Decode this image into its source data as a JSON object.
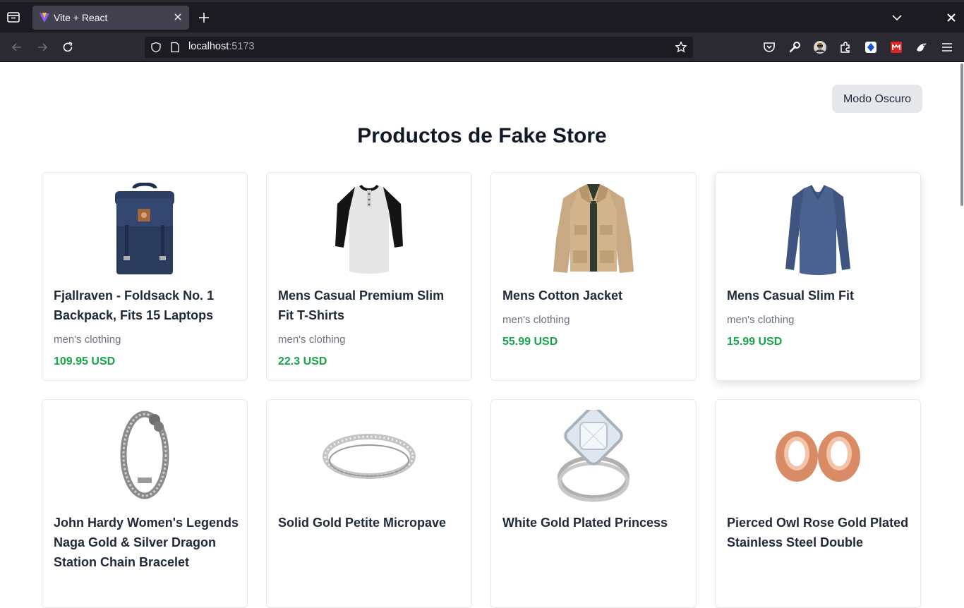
{
  "browser": {
    "tab_title": "Vite + React",
    "url_host": "localhost",
    "url_port": ":5173",
    "toolbar_icons": [
      "pocket-icon",
      "wrench-icon",
      "profile-avatar",
      "extensions-icon",
      "extension-blue-icon",
      "extension-red-icon",
      "extension-bird-icon",
      "menu-icon"
    ]
  },
  "page": {
    "mode_button": "Modo Oscuro",
    "title": "Productos de Fake Store"
  },
  "products": [
    {
      "name": "Fjallraven - Foldsack No. 1 Backpack, Fits 15 Laptops",
      "category": "men's clothing",
      "price": "109.95 USD",
      "image": "backpack"
    },
    {
      "name": "Mens Casual Premium Slim Fit T-Shirts",
      "category": "men's clothing",
      "price": "22.3 USD",
      "image": "raglan-shirt"
    },
    {
      "name": "Mens Cotton Jacket",
      "category": "men's clothing",
      "price": "55.99 USD",
      "image": "jacket"
    },
    {
      "name": "Mens Casual Slim Fit",
      "category": "men's clothing",
      "price": "15.99 USD",
      "image": "long-sleeve-shirt"
    },
    {
      "name": "John Hardy Women's Legends Naga Gold & Silver Dragon Station Chain Bracelet",
      "image": "bracelet"
    },
    {
      "name": "Solid Gold Petite Micropave",
      "image": "silver-ring"
    },
    {
      "name": "White Gold Plated Princess",
      "image": "diamond-ring"
    },
    {
      "name": "Pierced Owl Rose Gold Plated Stainless Steel Double",
      "image": "rose-gold-plugs"
    }
  ]
}
